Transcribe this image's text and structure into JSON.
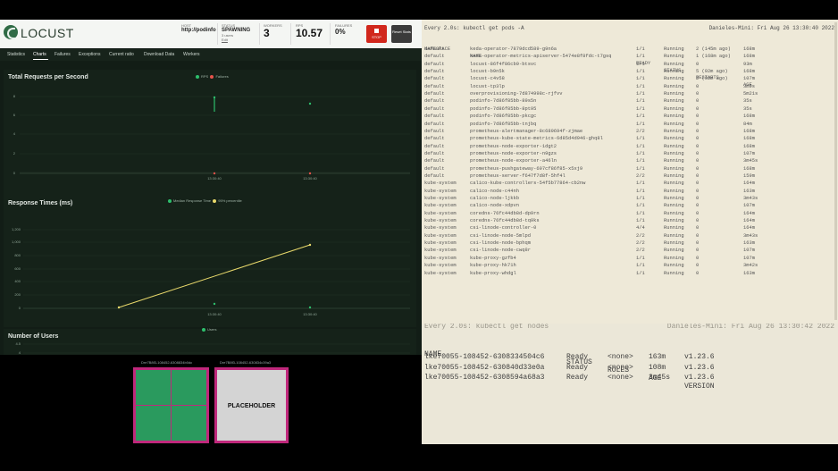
{
  "locust": {
    "logo": "LOCUST",
    "host": {
      "label": "HOST",
      "value": "http://podinfo"
    },
    "status": {
      "label": "STATUS",
      "value": "SPAWNING",
      "sub1": "3 users",
      "sub2": "Edit"
    },
    "workers": {
      "label": "WORKERS",
      "value": "3"
    },
    "rps": {
      "label": "RPS",
      "value": "10.57"
    },
    "failures": {
      "label": "FAILURES",
      "value": "0%"
    },
    "stop_label": "STOP",
    "reset_label": "Reset Stats",
    "tabs": [
      "Statistics",
      "Charts",
      "Failures",
      "Exceptions",
      "Current ratio",
      "Download Data",
      "Workers"
    ]
  },
  "charts": [
    {
      "title": "Total Requests per Second",
      "legend": [
        {
          "name": "RPS",
          "color": "#2dbe6c"
        },
        {
          "name": "Failures",
          "color": "#e5534b"
        }
      ],
      "y_ticks": [
        "10",
        "8",
        "6",
        "4",
        "2",
        "0"
      ],
      "x_ticks": [
        "13:30:40",
        "13:30:40"
      ]
    },
    {
      "title": "Response Times (ms)",
      "legend": [
        {
          "name": "Median Response Time",
          "color": "#2dbe6c"
        },
        {
          "name": "95% percentile",
          "color": "#e9d96b"
        }
      ],
      "y_ticks": [
        "1,200",
        "1,000",
        "800",
        "600",
        "400",
        "200",
        "0"
      ],
      "x_ticks": [
        "13:30:40",
        "13:30:40"
      ]
    },
    {
      "title": "Number of Users",
      "legend": [
        {
          "name": "Users",
          "color": "#2dbe6c"
        }
      ],
      "y_ticks": [
        "4.5",
        "4"
      ]
    }
  ],
  "tiles": {
    "a_label": "Dre7B8f3-108452-6308834b0dc",
    "b_label": "Dre7B8f3-108452-630834c39a3",
    "placeholder": "PLACEHOLDER"
  },
  "term_pods": {
    "cmd": "Every 2.0s: kubectl get pods -A",
    "clock": "Danieles-Mini: Fri Aug 26 13:30:40 2022",
    "headers": [
      "NAMESPACE",
      "NAME",
      "READY",
      "STATUS",
      "RESTARTS",
      "AGE"
    ],
    "rows": [
      [
        "default",
        "keda-operator-7879dcd589-g9n6a",
        "1/1",
        "Running",
        "2 (145m ago)",
        "168m"
      ],
      [
        "default",
        "keda-operator-metrics-apiserver-5474e8f8fdc-t7gsq",
        "1/1",
        "Running",
        "1 (168m ago)",
        "168m"
      ],
      [
        "default",
        "locust-86f4f86cb9-btsvc",
        "1/1",
        "Running",
        "0",
        "93m"
      ],
      [
        "default",
        "locust-b9n5k",
        "1/1",
        "Running",
        "5 (92m ago)",
        "168m"
      ],
      [
        "default",
        "locust-c4v58",
        "1/1",
        "Running",
        "2 (92m ago)",
        "107m"
      ],
      [
        "default",
        "locust-tp3lp",
        "1/1",
        "Running",
        "0",
        "3m9s"
      ],
      [
        "default",
        "overprovisioning-7d874998c-rjfvv",
        "1/1",
        "Running",
        "0",
        "5m21s"
      ],
      [
        "default",
        "podinfo-7d86f85bb-89s5n",
        "1/1",
        "Running",
        "0",
        "35s"
      ],
      [
        "default",
        "podinfo-7d86f85bb-8pt95",
        "1/1",
        "Running",
        "0",
        "35s"
      ],
      [
        "default",
        "podinfo-7d86f85bb-pkcgc",
        "1/1",
        "Running",
        "0",
        "168m"
      ],
      [
        "default",
        "podinfo-7d86f85bb-tnjbq",
        "1/1",
        "Running",
        "0",
        "84m"
      ],
      [
        "default",
        "prometheus-alertmanager-8c689694f-zjmae",
        "2/2",
        "Running",
        "0",
        "168m"
      ],
      [
        "default",
        "prometheus-kube-state-metrics-6d85d4d946-ghq8l",
        "1/1",
        "Running",
        "0",
        "168m"
      ],
      [
        "default",
        "prometheus-node-exporter-1dgt2",
        "1/1",
        "Running",
        "0",
        "168m"
      ],
      [
        "default",
        "prometheus-node-exporter-n9gzs",
        "1/1",
        "Running",
        "0",
        "107m"
      ],
      [
        "default",
        "prometheus-node-exporter-a46ln",
        "1/1",
        "Running",
        "0",
        "3m45s"
      ],
      [
        "default",
        "prometheus-pushgateway-697cf86f85-x5xj9",
        "1/1",
        "Running",
        "0",
        "168m"
      ],
      [
        "default",
        "prometheus-server-f647f7d8f-5hf4l",
        "2/2",
        "Running",
        "0",
        "159m"
      ],
      [
        "kube-system",
        "calico-kube-controllers-54f5b77864-cb2nw",
        "1/1",
        "Running",
        "0",
        "164m"
      ],
      [
        "kube-system",
        "calico-node-c44nh",
        "1/1",
        "Running",
        "0",
        "163m"
      ],
      [
        "kube-system",
        "calico-node-ljkkb",
        "1/1",
        "Running",
        "0",
        "3m43s"
      ],
      [
        "kube-system",
        "calico-node-xdpvn",
        "1/1",
        "Running",
        "0",
        "107m"
      ],
      [
        "kube-system",
        "coredns-76fc44db8d-dp9rn",
        "1/1",
        "Running",
        "0",
        "164m"
      ],
      [
        "kube-system",
        "coredns-76fc44db8d-tq9ks",
        "1/1",
        "Running",
        "0",
        "164m"
      ],
      [
        "kube-system",
        "csi-linode-controller-0",
        "4/4",
        "Running",
        "0",
        "164m"
      ],
      [
        "kube-system",
        "csi-linode-node-5mlpd",
        "2/2",
        "Running",
        "0",
        "3m43s"
      ],
      [
        "kube-system",
        "csi-linode-node-bphqm",
        "2/2",
        "Running",
        "0",
        "163m"
      ],
      [
        "kube-system",
        "csi-linode-node-cwq8r",
        "2/2",
        "Running",
        "0",
        "107m"
      ],
      [
        "kube-system",
        "kube-proxy-gzfb4",
        "1/1",
        "Running",
        "0",
        "107m"
      ],
      [
        "kube-system",
        "kube-proxy-hk71h",
        "1/1",
        "Running",
        "0",
        "3m42s"
      ],
      [
        "kube-system",
        "kube-proxy-whdgl",
        "1/1",
        "Running",
        "0",
        "163m"
      ]
    ]
  },
  "term_nodes": {
    "cmd": "Every 2.0s: kubectl get nodes",
    "clock": "Danieles-Mini: Fri Aug 26 13:30:42 2022",
    "headers": [
      "NAME",
      "STATUS",
      "ROLES",
      "AGE",
      "VERSION"
    ],
    "rows": [
      [
        "lke70055-108452-6308334504c6",
        "Ready",
        "<none>",
        "163m",
        "v1.23.6"
      ],
      [
        "lke70055-108452-630840d33e0a",
        "Ready",
        "<none>",
        "108m",
        "v1.23.6"
      ],
      [
        "lke70055-108452-6308594a68a3",
        "Ready",
        "<none>",
        "3m45s",
        "v1.23.6"
      ]
    ]
  },
  "colors": {
    "accent_green": "#2dbe6c",
    "stop_red": "#d1271c",
    "tile_border": "#c0287c",
    "terminal_bg": "#eee9d8"
  }
}
